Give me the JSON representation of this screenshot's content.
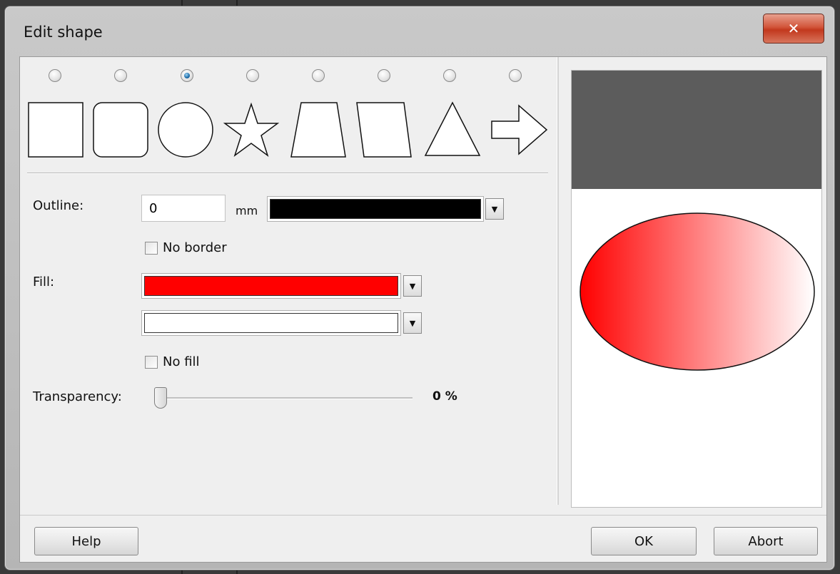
{
  "window": {
    "title": "Edit shape",
    "close_glyph": "✕"
  },
  "shapes": {
    "options": [
      {
        "name": "rectangle",
        "selected": false
      },
      {
        "name": "rounded-rectangle",
        "selected": false
      },
      {
        "name": "ellipse",
        "selected": true
      },
      {
        "name": "star",
        "selected": false
      },
      {
        "name": "trapezoid",
        "selected": false
      },
      {
        "name": "parallelogram",
        "selected": false
      },
      {
        "name": "triangle",
        "selected": false
      },
      {
        "name": "arrow",
        "selected": false
      }
    ]
  },
  "outline": {
    "label": "Outline:",
    "value": "0",
    "unit": "mm",
    "color": "#000000"
  },
  "no_border": {
    "label": "No border",
    "checked": false
  },
  "fill": {
    "label": "Fill:",
    "color1": "#ff0000",
    "color2": "#ffffff"
  },
  "no_fill": {
    "label": "No fill",
    "checked": false
  },
  "transparency": {
    "label": "Transparency:",
    "value": "0 %",
    "percent": 0
  },
  "buttons": {
    "help": "Help",
    "ok": "OK",
    "abort": "Abort"
  },
  "dropdown_glyph": "▼",
  "preview": {
    "header_color": "#5c5c5c",
    "shape": "ellipse",
    "fill_from": "#ff0000",
    "fill_to": "#ffffff"
  }
}
